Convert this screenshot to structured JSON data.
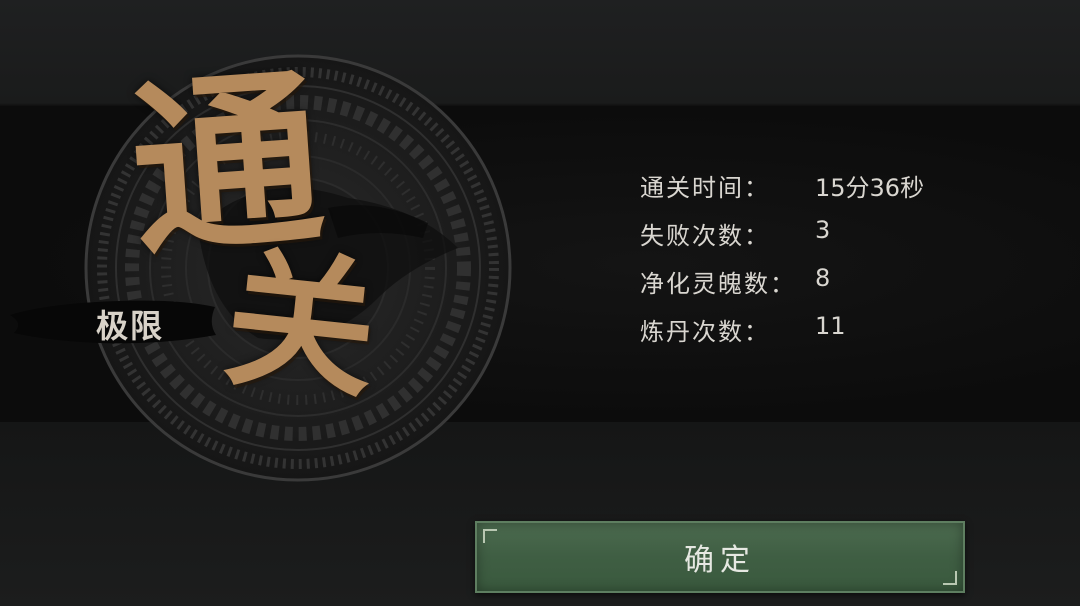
{
  "title": {
    "char1": "通",
    "char2": "关"
  },
  "difficulty": "极限",
  "stats": [
    {
      "label": "通关时间：",
      "value": "15分36秒"
    },
    {
      "label": "失败次数：",
      "value": "3"
    },
    {
      "label": "净化灵魄数：",
      "value": "8"
    },
    {
      "label": "炼丹次数：",
      "value": "11"
    }
  ],
  "confirm_label": "确定",
  "colors": {
    "gold": "#b58a5c",
    "button_green": "#3f5e43",
    "text": "#d9d6d0"
  }
}
